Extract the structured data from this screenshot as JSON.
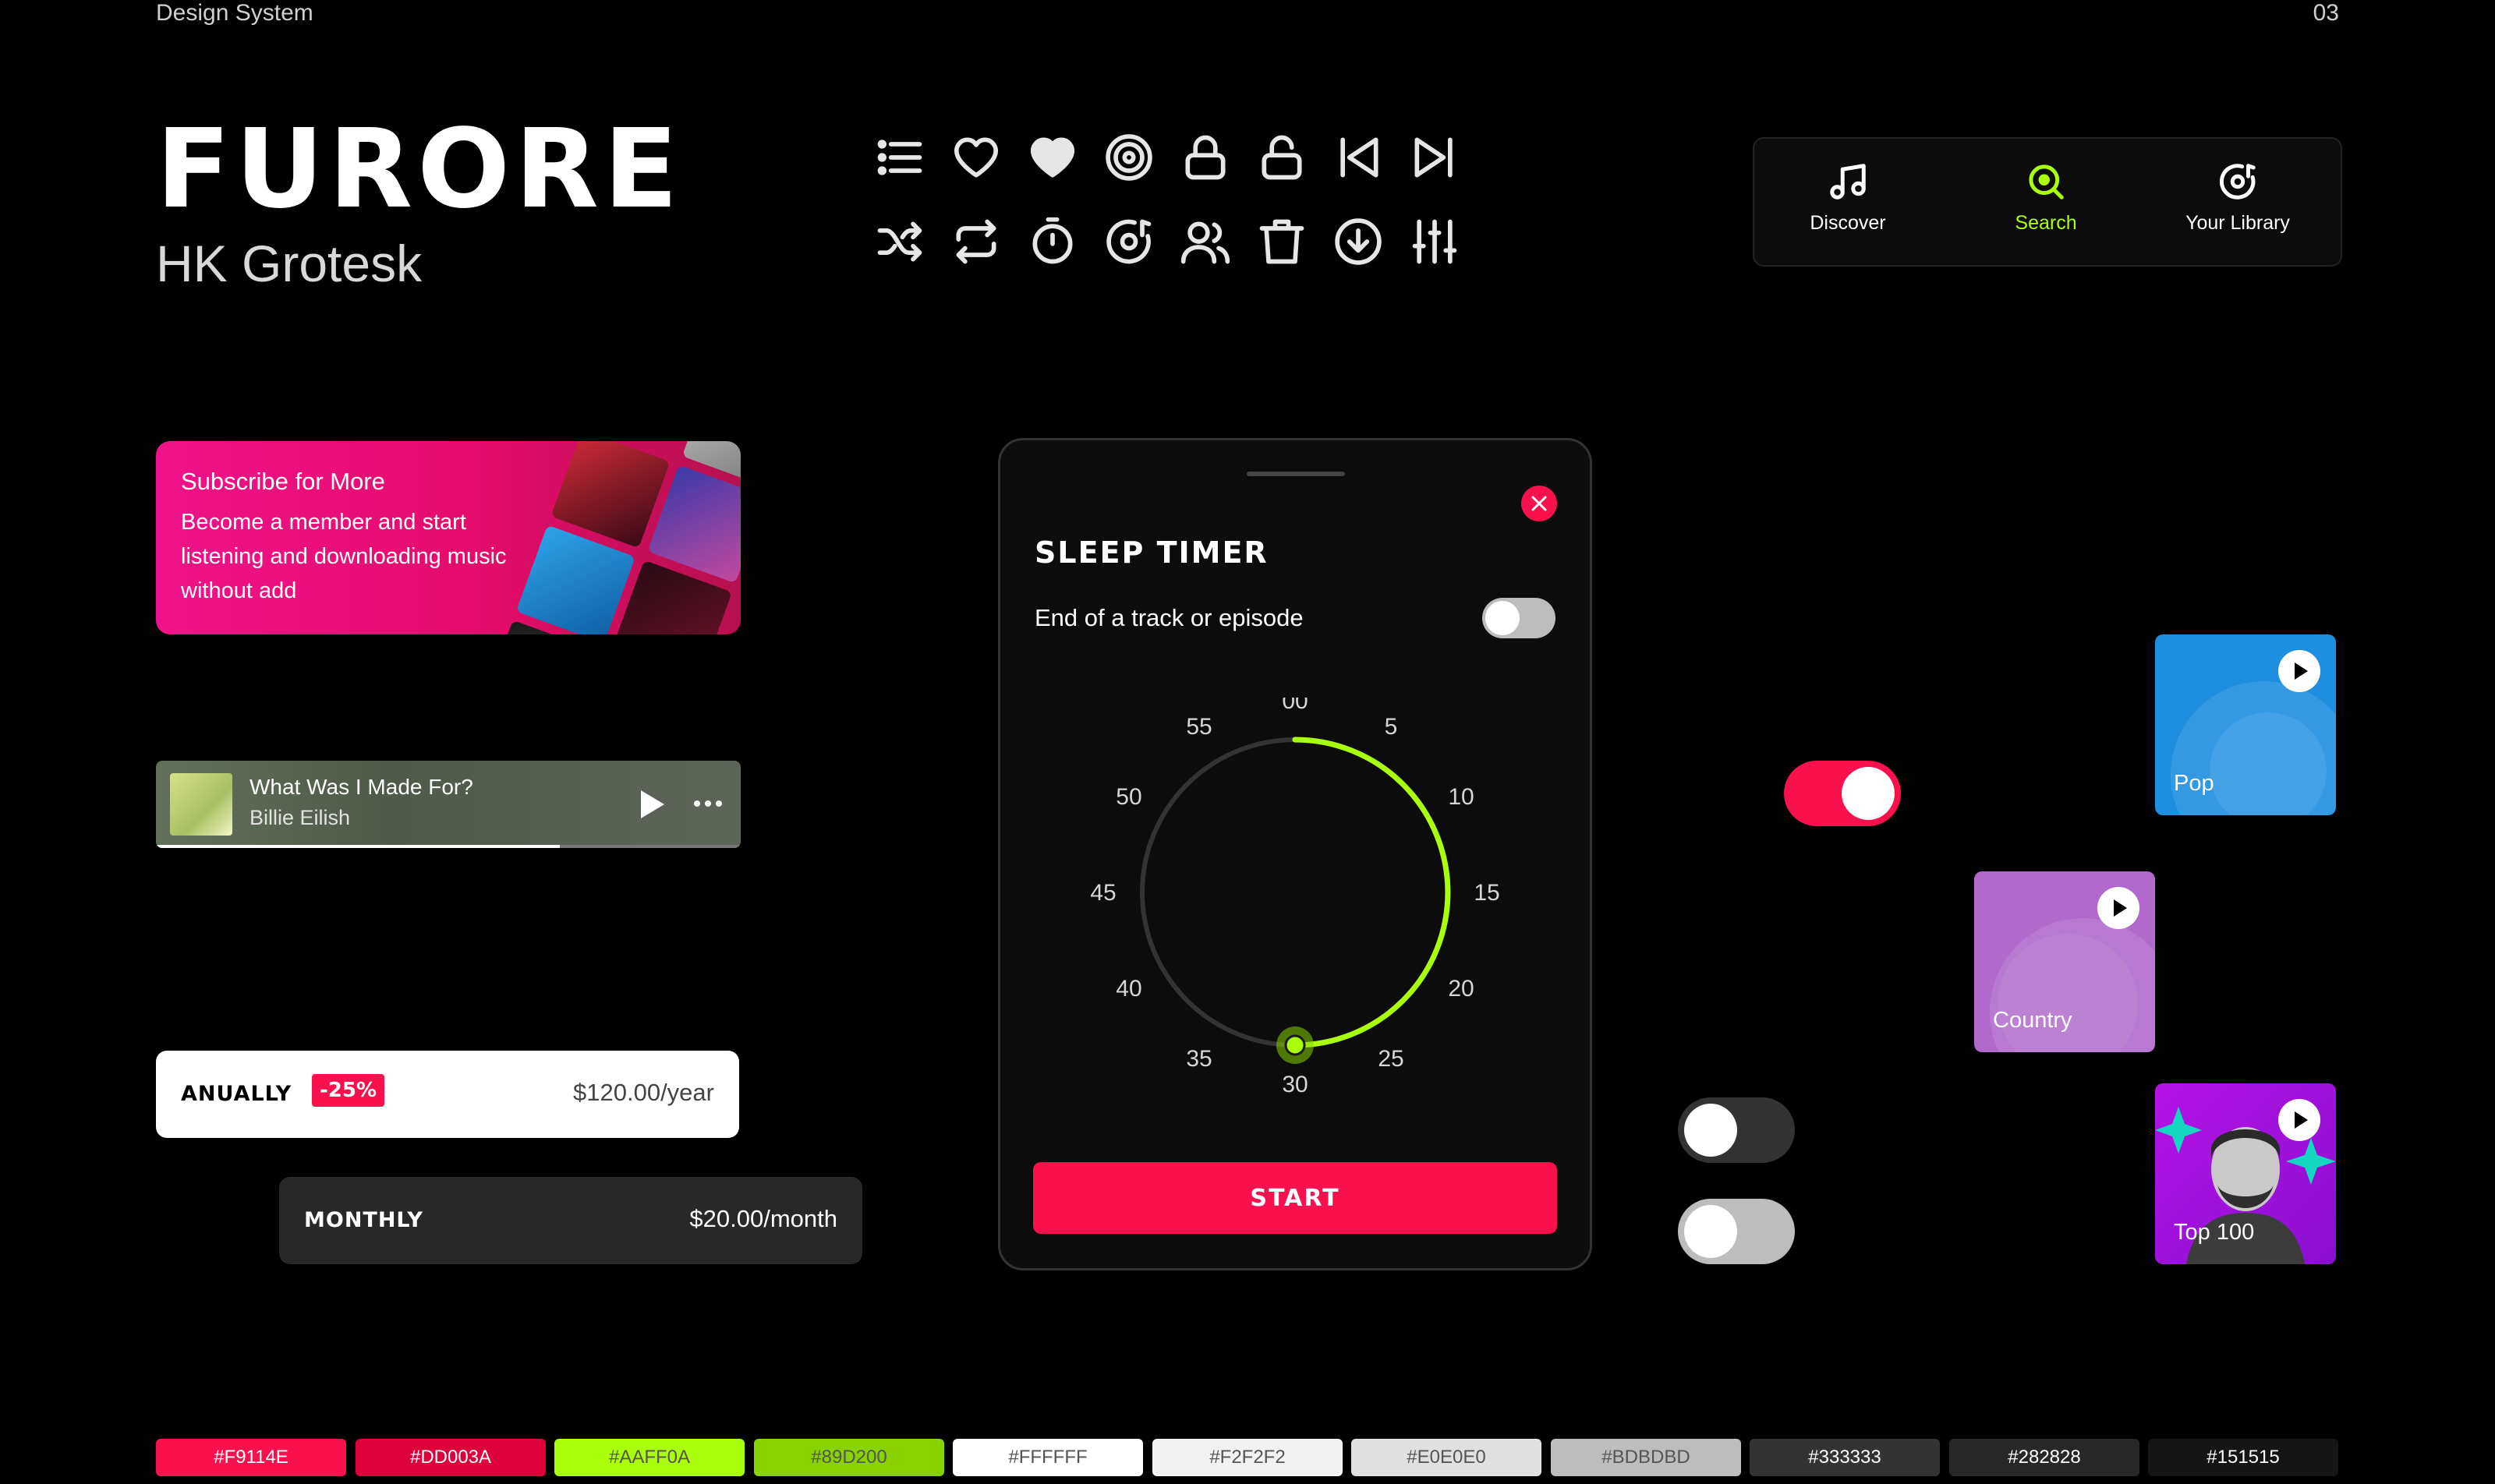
{
  "header": {
    "section": "Design System",
    "page_number": "03"
  },
  "typography": {
    "display_font": "FURORE",
    "text_font": "HK Grotesk"
  },
  "icons": [
    "list-icon",
    "heart-outline-icon",
    "heart-filled-icon",
    "vinyl-icon",
    "lock-icon",
    "unlock-icon",
    "skip-back-icon",
    "skip-forward-icon",
    "shuffle-icon",
    "repeat-icon",
    "timer-icon",
    "music-disc-icon",
    "users-icon",
    "trash-icon",
    "download-icon",
    "equalizer-icon"
  ],
  "nav": {
    "items": [
      {
        "label": "Discover",
        "icon": "music-note-icon",
        "active": false
      },
      {
        "label": "Search",
        "icon": "search-icon",
        "active": true
      },
      {
        "label": "Your Library",
        "icon": "library-icon",
        "active": false
      }
    ]
  },
  "promo": {
    "title": "Subscribe for More",
    "body": "Become a member and start listening and downloading music without add"
  },
  "player": {
    "track": "What Was I Made For?",
    "artist": "Billie Eilish",
    "progress": 0.69
  },
  "plans": {
    "annual": {
      "label": "ANUALLY",
      "badge": "-25%",
      "price": "$120.00/year"
    },
    "monthly": {
      "label": "MONTHLY",
      "price": "$20.00/month"
    }
  },
  "sleep_timer": {
    "title": "SLEEP TIMER",
    "option_label": "End of a track or episode",
    "option_enabled": false,
    "ticks": [
      "00",
      "5",
      "10",
      "15",
      "20",
      "25",
      "30",
      "35",
      "40",
      "45",
      "50",
      "55"
    ],
    "selected_minutes": 30,
    "max_minutes": 60,
    "start_label": "START"
  },
  "toggles": [
    {
      "name": "toggle-red",
      "on": true
    },
    {
      "name": "toggle-dark",
      "on": false
    },
    {
      "name": "toggle-light",
      "on": false
    }
  ],
  "genres": [
    {
      "label": "Pop",
      "color": "#1E8EE0"
    },
    {
      "label": "Country",
      "color": "#B169CC"
    },
    {
      "label": "Top 100",
      "color": "#B513E5"
    }
  ],
  "palette": [
    {
      "hex": "#F9114E",
      "text": "light"
    },
    {
      "hex": "#DD003A",
      "text": "light"
    },
    {
      "hex": "#AAFF0A",
      "text": "dark"
    },
    {
      "hex": "#89D200",
      "text": "dark"
    },
    {
      "hex": "#FFFFFF",
      "text": "dark"
    },
    {
      "hex": "#F2F2F2",
      "text": "dark"
    },
    {
      "hex": "#E0E0E0",
      "text": "dark"
    },
    {
      "hex": "#BDBDBD",
      "text": "dark"
    },
    {
      "hex": "#333333",
      "text": "light"
    },
    {
      "hex": "#282828",
      "text": "light"
    },
    {
      "hex": "#151515",
      "text": "light"
    }
  ],
  "colors": {
    "primary": "#F9114E",
    "accent": "#AAFF0A",
    "surface": "#0C0C0C"
  }
}
